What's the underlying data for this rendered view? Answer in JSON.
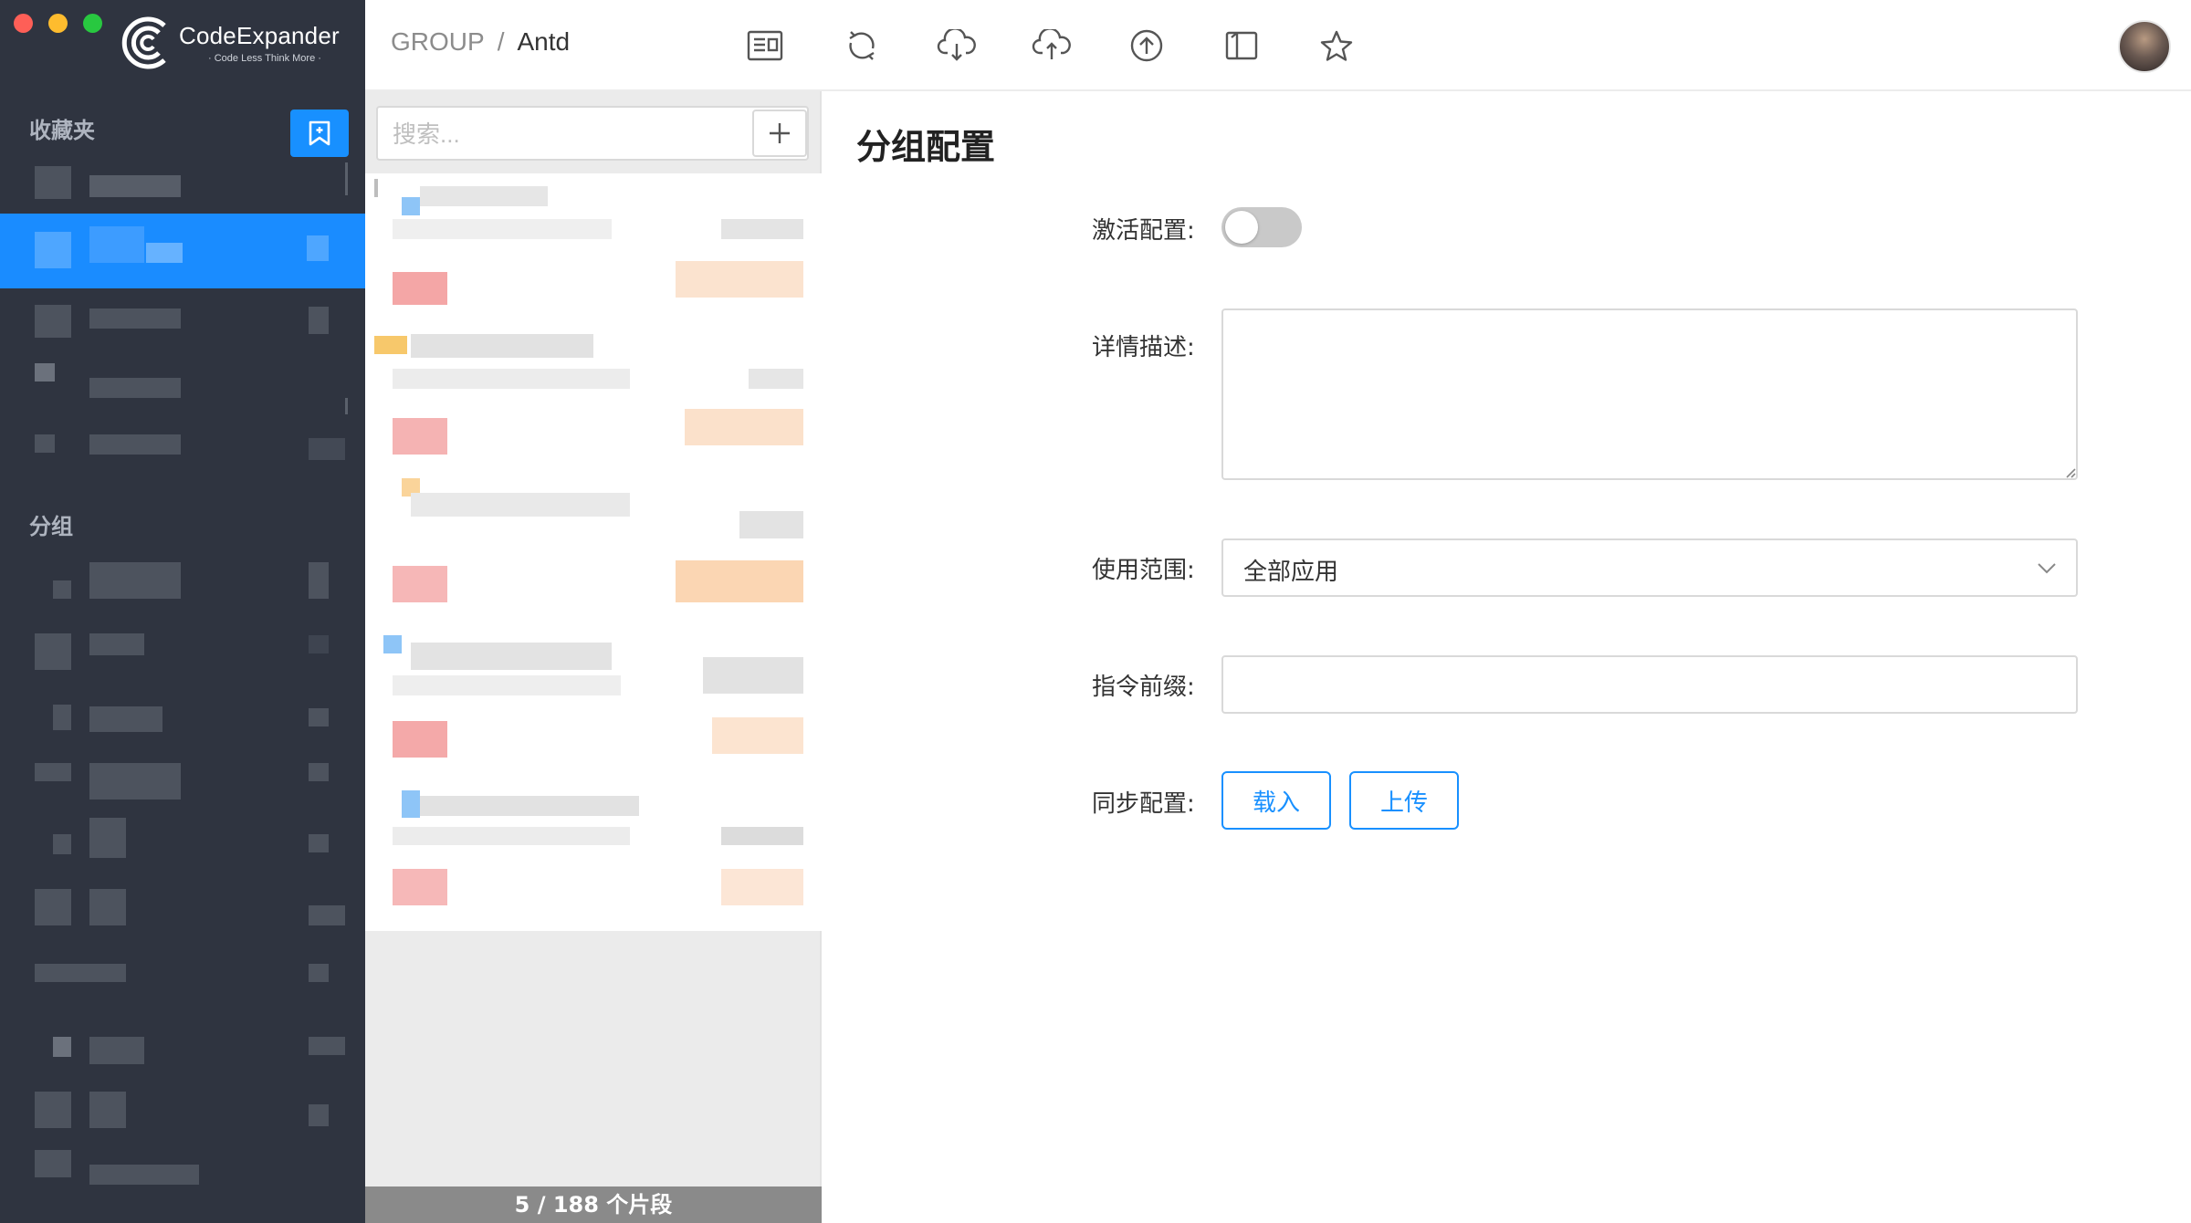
{
  "app": {
    "name": "CodeExpander",
    "slogan": "· Code Less Think More ·"
  },
  "sidebar": {
    "favorites_title": "收藏夹",
    "groups_title": "分组",
    "add_favorite_icon": "bookmark-add-icon"
  },
  "header": {
    "breadcrumb": [
      "GROUP",
      "Antd"
    ],
    "toolbar_icons": [
      "import-icon",
      "sync-icon",
      "cloud-download-icon",
      "cloud-upload-icon",
      "upload-icon",
      "book-icon",
      "star-icon"
    ]
  },
  "list": {
    "search_placeholder": "搜索...",
    "add_icon": "plus-icon",
    "footer": "5 / 188 个片段"
  },
  "main": {
    "title": "分组配置",
    "active_label": "激活配置:",
    "active_value": false,
    "description_label": "详情描述:",
    "description_value": "",
    "scope_label": "使用范围:",
    "scope_value": "全部应用",
    "prefix_label": "指令前缀:",
    "prefix_value": "",
    "sync_label": "同步配置:",
    "load_button": "载入",
    "upload_button": "上传"
  },
  "colors": {
    "sidebar_bg": "#2f3440",
    "accent": "#1890ff",
    "active_item": "#1a8cff"
  }
}
